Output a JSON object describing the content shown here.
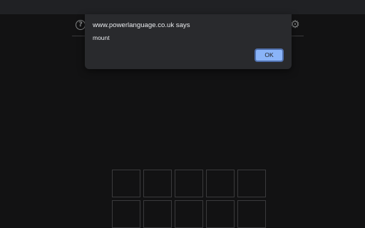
{
  "dialog": {
    "title": "www.powerlanguage.co.uk says",
    "message": "mount",
    "ok_label": "OK"
  },
  "header": {
    "help_icon": "help-icon",
    "help_glyph": "?",
    "settings_icon": "gear-icon",
    "settings_glyph": "⚙"
  },
  "board": {
    "visible_rows": 2,
    "columns": 5,
    "tiles": [
      "",
      "",
      "",
      "",
      "",
      "",
      "",
      "",
      "",
      ""
    ]
  },
  "colors": {
    "background": "#121213",
    "browser_bar": "#202124",
    "dialog": "#292a2d",
    "tile_border": "#3a3a3c",
    "accent": "#8ab4f8"
  }
}
